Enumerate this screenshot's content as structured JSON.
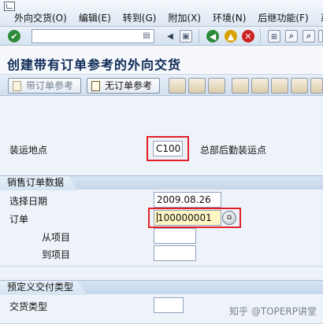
{
  "menubar": {
    "items": [
      "外向交货(O)",
      "编辑(E)",
      "转到(G)",
      "附加(X)",
      "环境(N)",
      "后继功能(F)",
      "系"
    ]
  },
  "toolbar": {
    "command_field_value": ""
  },
  "title": "创建带有订单参考的外向交货",
  "app_toolbar": {
    "with_order_ref": "带订单参考",
    "without_order_ref": "无订单参考"
  },
  "form": {
    "shipping_point_label": "装运地点",
    "shipping_point_value": "C100",
    "shipping_point_desc": "总部后勤装运点",
    "sales_order_group": {
      "title": "销售订单数据",
      "selection_date_label": "选择日期",
      "selection_date_value": "2009.08.26",
      "order_label": "订单",
      "order_value": "100000001",
      "from_item_label": "从项目",
      "from_item_value": "",
      "to_item_label": "到项目",
      "to_item_value": ""
    },
    "delivery_type_group": {
      "title": "预定义交付类型",
      "delivery_type_label": "交货类型",
      "delivery_type_value": ""
    }
  },
  "watermark": "知乎 @TOPERP讲堂",
  "colors": {
    "title_text": "#0d2a57",
    "highlight_border": "#e21f26",
    "focused_field_bg": "#fff6c4",
    "enter_icon": "#2e8b3a",
    "back_icon": "#2c8a3a",
    "exit_icon": "#d8a100",
    "cancel_icon": "#cc2222"
  },
  "icons": {
    "enter": "check-icon",
    "save": "save-icon",
    "back": "back-icon",
    "exit": "exit-icon",
    "cancel": "cancel-icon",
    "print": "print-icon",
    "find": "find-icon",
    "find_next": "find-next-icon",
    "first_page": "first-page-icon",
    "search_help": "search-help-icon"
  }
}
